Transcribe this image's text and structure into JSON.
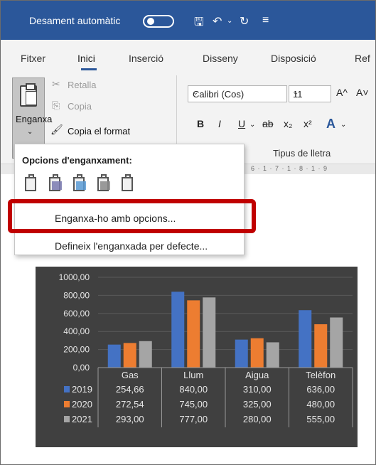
{
  "titlebar": {
    "autosave_label": "Desament automàtic",
    "icons": [
      "save-icon",
      "undo-icon",
      "redo-icon",
      "customize-icon"
    ]
  },
  "tabs": [
    "Fitxer",
    "Inici",
    "Inserció",
    "Disseny",
    "Disposició",
    "Ref"
  ],
  "active_tab": "Inici",
  "clipboard": {
    "paste": "Enganxa",
    "cut": "Retalla",
    "copy": "Copia",
    "format_painter": "Copia el format"
  },
  "font": {
    "name": "Calibri (Cos)",
    "size": "11",
    "bold": "B",
    "italic": "I",
    "underline": "U",
    "strike": "ab",
    "subscript": "x₂",
    "superscript": "x²",
    "grow": "A^",
    "shrink": "A˅",
    "text_effects": "A",
    "group_label": "Tipus de lletra"
  },
  "ruler_text": "6 · 1 · 7 · 1 · 8 · 1 · 9",
  "paste_menu": {
    "title": "Opcions d'enganxament:",
    "option_icons": [
      "paste-keep-source-icon",
      "paste-merge-format-icon",
      "paste-picture-icon",
      "paste-link-icon",
      "paste-text-only-icon"
    ],
    "items": [
      {
        "label": "Enganxa-ho amb opcions...",
        "highlighted": true
      },
      {
        "label": "Defineix l'enganxada per defecte..."
      }
    ]
  },
  "highlight_color": "#c00000",
  "chart_data": {
    "type": "bar",
    "categories": [
      "Gas",
      "Llum",
      "Aigua",
      "Telèfon"
    ],
    "series": [
      {
        "name": "2019",
        "values": [
          254.66,
          840.0,
          310.0,
          636.0
        ],
        "color": "#4472c4",
        "labels": [
          "254,66",
          "840,00",
          "310,00",
          "636,00"
        ]
      },
      {
        "name": "2020",
        "values": [
          272.54,
          745.0,
          325.0,
          480.0
        ],
        "color": "#ed7d31",
        "labels": [
          "272,54",
          "745,00",
          "325,00",
          "480,00"
        ]
      },
      {
        "name": "2021",
        "values": [
          293.0,
          777.0,
          280.0,
          555.0
        ],
        "color": "#a5a5a5",
        "labels": [
          "293,00",
          "777,00",
          "280,00",
          "555,00"
        ]
      }
    ],
    "ylim": [
      0,
      1000
    ],
    "ytick_labels": [
      "0,00",
      "200,00",
      "400,00",
      "600,00",
      "800,00",
      "1000,00"
    ],
    "legend": "data-table",
    "grid": true,
    "background": "#404040"
  }
}
